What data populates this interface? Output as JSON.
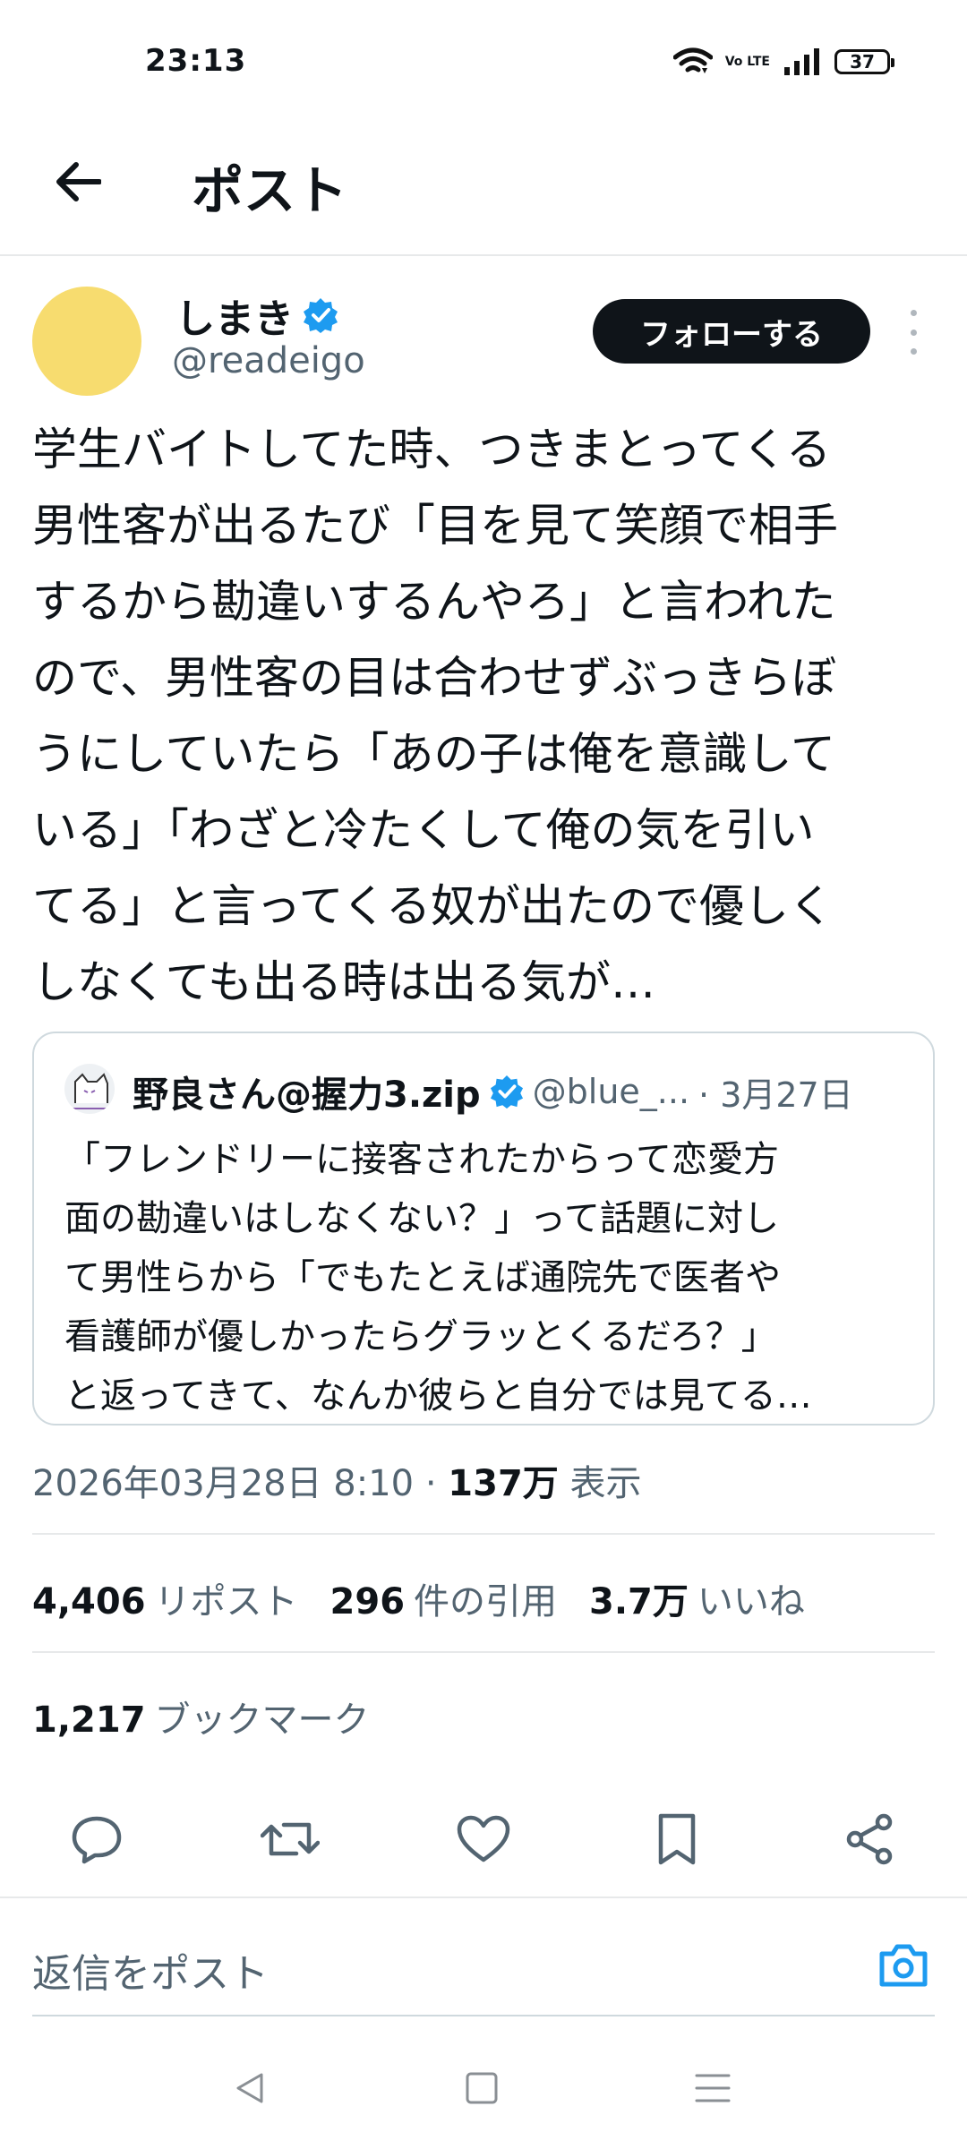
{
  "status_bar": {
    "time": "23:13",
    "battery": "37",
    "network_label": "Vo LTE"
  },
  "header": {
    "title": "ポスト"
  },
  "post": {
    "display_name": "しまき",
    "handle": "@readeigo",
    "follow_label": "フォローする",
    "text": "学生バイトしてた時、つきまとってくる\n男性客が出るたび「目を見て笑顔で相手\nするから勘違いするんやろ」と言われた\nので、男性客の目は合わせずぶっきらぼ\nうにしていたら「あの子は俺を意識して\nいる」「わざと冷たくして俺の気を引い\nてる」と言ってくる奴が出たので優しく\nしなくても出る時は出る気が…",
    "avatar_color": "#f7dc6f",
    "verified_color": "#1d9bf0"
  },
  "quote": {
    "display_name": "野良さん@握力3.zip",
    "handle": "@blue_...",
    "date": "· 3月27日",
    "text": "「フレンドリーに接客されたからって恋愛方\n面の勘違いはしなくない？」って話題に対し\nて男性らから「でもたとえば通院先で医者や\n看護師が優しかったらグラッとくるだろ？」\nと返ってきて、なんか彼らと自分では見てる…"
  },
  "meta": {
    "timestamp": "2026年03月28日 8:10 · ",
    "views_count": "137万",
    "views_label": " 表示"
  },
  "stats": {
    "reposts_count": "4,406",
    "reposts_label": "リポスト",
    "quotes_count": "296",
    "quotes_label": "件の引用",
    "likes_count": "3.7万",
    "likes_label": "いいね"
  },
  "bookmarks": {
    "count": "1,217",
    "label": "ブックマーク"
  },
  "actions": {
    "icons": [
      "reply-icon",
      "repost-icon",
      "like-icon",
      "bookmark-icon",
      "share-icon"
    ]
  },
  "reply_bar": {
    "placeholder": "返信をポスト",
    "accent": "#1d9bf0"
  },
  "nav_bar": {
    "icons": [
      "back-triangle-icon",
      "home-square-icon",
      "menu-lines-icon"
    ]
  }
}
